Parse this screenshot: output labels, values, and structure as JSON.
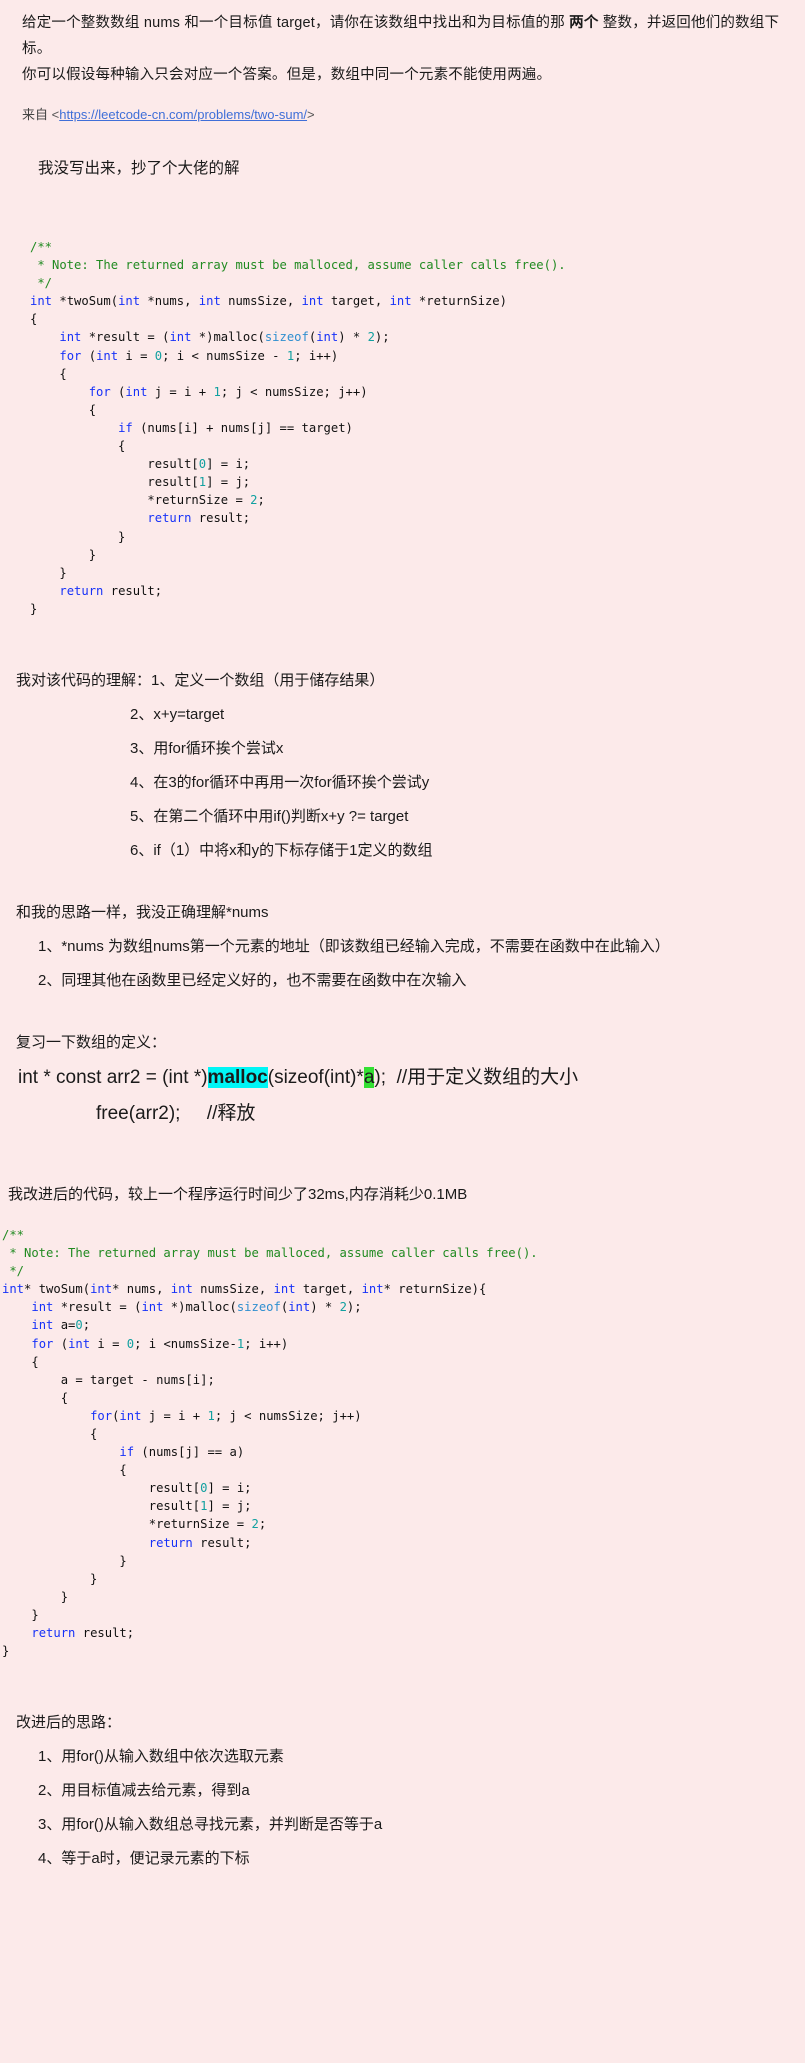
{
  "problem": {
    "line1_a": "给定一个整数数组 nums 和一个目标值 target，请你在该数组中找出和为目标值的那 ",
    "line1_b": "两个",
    "line1_c": " 整数，并返回他们的数组下标。",
    "line2": "你可以假设每种输入只会对应一个答案。但是，数组中同一个元素不能使用两遍。"
  },
  "source": {
    "prefix": "来自 ",
    "open_angle": "<",
    "url": "https://leetcode-cn.com/problems/two-sum/",
    "close_angle": ">"
  },
  "note_heading": "我没写出来，抄了个大佬的解",
  "code_block_1": {
    "lines": [
      [
        {
          "t": "/**",
          "c": "cm"
        }
      ],
      [
        {
          "t": " * Note: The returned array must be malloced, assume caller calls free().",
          "c": "cm"
        }
      ],
      [
        {
          "t": " */",
          "c": "cm"
        }
      ],
      [
        {
          "t": "int",
          "c": "kw"
        },
        {
          "t": " *twoSum(",
          "c": "fn"
        },
        {
          "t": "int",
          "c": "kw"
        },
        {
          "t": " *nums, ",
          "c": "fn"
        },
        {
          "t": "int",
          "c": "kw"
        },
        {
          "t": " numsSize, ",
          "c": "fn"
        },
        {
          "t": "int",
          "c": "kw"
        },
        {
          "t": " target, ",
          "c": "fn"
        },
        {
          "t": "int",
          "c": "kw"
        },
        {
          "t": " *returnSize)",
          "c": "fn"
        }
      ],
      [
        {
          "t": "{",
          "c": "fn"
        }
      ],
      [
        {
          "t": "    ",
          "c": "fn"
        },
        {
          "t": "int",
          "c": "kw"
        },
        {
          "t": " *result = (",
          "c": "fn"
        },
        {
          "t": "int",
          "c": "kw"
        },
        {
          "t": " *)malloc(",
          "c": "fn"
        },
        {
          "t": "sizeof",
          "c": "pp"
        },
        {
          "t": "(",
          "c": "fn"
        },
        {
          "t": "int",
          "c": "kw"
        },
        {
          "t": ") * ",
          "c": "fn"
        },
        {
          "t": "2",
          "c": "num"
        },
        {
          "t": ");",
          "c": "fn"
        }
      ],
      [
        {
          "t": "    ",
          "c": "fn"
        },
        {
          "t": "for",
          "c": "kw"
        },
        {
          "t": " (",
          "c": "fn"
        },
        {
          "t": "int",
          "c": "kw"
        },
        {
          "t": " i = ",
          "c": "fn"
        },
        {
          "t": "0",
          "c": "num"
        },
        {
          "t": "; i < numsSize - ",
          "c": "fn"
        },
        {
          "t": "1",
          "c": "num"
        },
        {
          "t": "; i++)",
          "c": "fn"
        }
      ],
      [
        {
          "t": "    {",
          "c": "fn"
        }
      ],
      [
        {
          "t": "        ",
          "c": "fn"
        },
        {
          "t": "for",
          "c": "kw"
        },
        {
          "t": " (",
          "c": "fn"
        },
        {
          "t": "int",
          "c": "kw"
        },
        {
          "t": " j = i + ",
          "c": "fn"
        },
        {
          "t": "1",
          "c": "num"
        },
        {
          "t": "; j < numsSize; j++)",
          "c": "fn"
        }
      ],
      [
        {
          "t": "        {",
          "c": "fn"
        }
      ],
      [
        {
          "t": "            ",
          "c": "fn"
        },
        {
          "t": "if",
          "c": "kw"
        },
        {
          "t": " (nums[i] + nums[j] == target)",
          "c": "fn"
        }
      ],
      [
        {
          "t": "            {",
          "c": "fn"
        }
      ],
      [
        {
          "t": "                result[",
          "c": "fn"
        },
        {
          "t": "0",
          "c": "num"
        },
        {
          "t": "] = i;",
          "c": "fn"
        }
      ],
      [
        {
          "t": "                result[",
          "c": "fn"
        },
        {
          "t": "1",
          "c": "num"
        },
        {
          "t": "] = j;",
          "c": "fn"
        }
      ],
      [
        {
          "t": "                *returnSize = ",
          "c": "fn"
        },
        {
          "t": "2",
          "c": "num"
        },
        {
          "t": ";",
          "c": "fn"
        }
      ],
      [
        {
          "t": "                ",
          "c": "fn"
        },
        {
          "t": "return",
          "c": "kw"
        },
        {
          "t": " result;",
          "c": "fn"
        }
      ],
      [
        {
          "t": "            }",
          "c": "fn"
        }
      ],
      [
        {
          "t": "        }",
          "c": "fn"
        }
      ],
      [
        {
          "t": "    }",
          "c": "fn"
        }
      ],
      [
        {
          "t": "    ",
          "c": "fn"
        },
        {
          "t": "return",
          "c": "kw"
        },
        {
          "t": " result;",
          "c": "fn"
        }
      ],
      [
        {
          "t": "}",
          "c": "fn"
        }
      ]
    ]
  },
  "understanding": {
    "lead": "我对该代码的理解：1、定义一个数组（用于储存结果）",
    "items": [
      "2、x+y=target",
      "3、用for循环挨个尝试x",
      "4、在3的for循环中再用一次for循环挨个尝试y",
      "5、在第二个循环中用if()判断x+y ?= target",
      "6、if（1）中将x和y的下标存储于1定义的数组"
    ]
  },
  "pointer_section": {
    "heading": "和我的思路一样，我没正确理解*nums",
    "item1": "1、*nums 为数组nums第一个元素的地址（即该数组已经输入完成，不需要在函数中在此输入）",
    "item2": "2、同理其他在函数里已经定义好的，也不需要在函数中在次输入"
  },
  "array_review": {
    "heading": "复习一下数组的定义：",
    "snippet_pre": "int * const arr2 = (int *)",
    "snippet_hl_cyan": "malloc",
    "snippet_mid": "(sizeof(int)*",
    "snippet_hl_green": "a",
    "snippet_post": ");  //用于定义数组的大小",
    "snippet_line2": "free(arr2);     //释放"
  },
  "improved_heading": "我改进后的代码，较上一个程序运行时间少了32ms,内存消耗少0.1MB",
  "code_block_2": {
    "lines": [
      [
        {
          "t": "/**",
          "c": "cm"
        }
      ],
      [
        {
          "t": " * Note: The returned array must be malloced, assume caller calls free().",
          "c": "cm"
        }
      ],
      [
        {
          "t": " */",
          "c": "cm"
        }
      ],
      [
        {
          "t": "int",
          "c": "kw"
        },
        {
          "t": "* twoSum(",
          "c": "fn"
        },
        {
          "t": "int",
          "c": "kw"
        },
        {
          "t": "* nums, ",
          "c": "fn"
        },
        {
          "t": "int",
          "c": "kw"
        },
        {
          "t": " numsSize, ",
          "c": "fn"
        },
        {
          "t": "int",
          "c": "kw"
        },
        {
          "t": " target, ",
          "c": "fn"
        },
        {
          "t": "int",
          "c": "kw"
        },
        {
          "t": "* returnSize){",
          "c": "fn"
        }
      ],
      [
        {
          "t": "    ",
          "c": "fn"
        },
        {
          "t": "int",
          "c": "kw"
        },
        {
          "t": " *result = (",
          "c": "fn"
        },
        {
          "t": "int",
          "c": "kw"
        },
        {
          "t": " *)malloc(",
          "c": "fn"
        },
        {
          "t": "sizeof",
          "c": "pp"
        },
        {
          "t": "(",
          "c": "fn"
        },
        {
          "t": "int",
          "c": "kw"
        },
        {
          "t": ") * ",
          "c": "fn"
        },
        {
          "t": "2",
          "c": "num"
        },
        {
          "t": ");",
          "c": "fn"
        }
      ],
      [
        {
          "t": "    ",
          "c": "fn"
        },
        {
          "t": "int",
          "c": "kw"
        },
        {
          "t": " a=",
          "c": "fn"
        },
        {
          "t": "0",
          "c": "num"
        },
        {
          "t": ";",
          "c": "fn"
        }
      ],
      [
        {
          "t": "    ",
          "c": "fn"
        },
        {
          "t": "for",
          "c": "kw"
        },
        {
          "t": " (",
          "c": "fn"
        },
        {
          "t": "int",
          "c": "kw"
        },
        {
          "t": " i = ",
          "c": "fn"
        },
        {
          "t": "0",
          "c": "num"
        },
        {
          "t": "; i <numsSize-",
          "c": "fn"
        },
        {
          "t": "1",
          "c": "num"
        },
        {
          "t": "; i++)",
          "c": "fn"
        }
      ],
      [
        {
          "t": "    {",
          "c": "fn"
        }
      ],
      [
        {
          "t": "        a = target - nums[i];",
          "c": "fn"
        }
      ],
      [
        {
          "t": "        {",
          "c": "fn"
        }
      ],
      [
        {
          "t": "            ",
          "c": "fn"
        },
        {
          "t": "for",
          "c": "kw"
        },
        {
          "t": "(",
          "c": "fn"
        },
        {
          "t": "int",
          "c": "kw"
        },
        {
          "t": " j = i + ",
          "c": "fn"
        },
        {
          "t": "1",
          "c": "num"
        },
        {
          "t": "; j < numsSize; j++)",
          "c": "fn"
        }
      ],
      [
        {
          "t": "            {",
          "c": "fn"
        }
      ],
      [
        {
          "t": "                ",
          "c": "fn"
        },
        {
          "t": "if",
          "c": "kw"
        },
        {
          "t": " (nums[j] == a)",
          "c": "fn"
        }
      ],
      [
        {
          "t": "                {",
          "c": "fn"
        }
      ],
      [
        {
          "t": "                    result[",
          "c": "fn"
        },
        {
          "t": "0",
          "c": "num"
        },
        {
          "t": "] = i;",
          "c": "fn"
        }
      ],
      [
        {
          "t": "                    result[",
          "c": "fn"
        },
        {
          "t": "1",
          "c": "num"
        },
        {
          "t": "] = j;",
          "c": "fn"
        }
      ],
      [
        {
          "t": "                    *returnSize = ",
          "c": "fn"
        },
        {
          "t": "2",
          "c": "num"
        },
        {
          "t": ";",
          "c": "fn"
        }
      ],
      [
        {
          "t": "                    ",
          "c": "fn"
        },
        {
          "t": "return",
          "c": "kw"
        },
        {
          "t": " result;",
          "c": "fn"
        }
      ],
      [
        {
          "t": "                }",
          "c": "fn"
        }
      ],
      [
        {
          "t": "            }",
          "c": "fn"
        }
      ],
      [
        {
          "t": "        }",
          "c": "fn"
        }
      ],
      [
        {
          "t": "    }",
          "c": "fn"
        }
      ],
      [
        {
          "t": "    ",
          "c": "fn"
        },
        {
          "t": "return",
          "c": "kw"
        },
        {
          "t": " result;",
          "c": "fn"
        }
      ],
      [
        {
          "t": "}",
          "c": "fn"
        }
      ]
    ]
  },
  "improved_thoughts": {
    "heading": "改进后的思路：",
    "items": [
      "1、用for()从输入数组中依次选取元素",
      "2、用目标值减去给元素，得到a",
      "3、用for()从输入数组总寻找元素，并判断是否等于a",
      "4、等于a时，便记录元素的下标"
    ]
  },
  "colors": {
    "background": "#fceaea",
    "link": "#3f6fd8",
    "comment": "#218a21",
    "keyword": "#1631f8",
    "number": "#12a0a0",
    "highlight_cyan": "#00f5f5",
    "highlight_green": "#33e033"
  }
}
